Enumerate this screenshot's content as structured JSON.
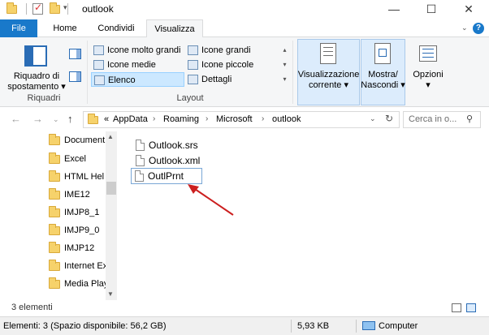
{
  "window": {
    "title": "outlook"
  },
  "ribbon": {
    "tabs": [
      "File",
      "Home",
      "Condividi",
      "Visualizza"
    ],
    "active_tab": "Visualizza",
    "panes_group": {
      "label": "Riquadri",
      "button_line1": "Riquadro di",
      "button_line2": "spostamento"
    },
    "layout_group": {
      "label": "Layout",
      "items": [
        "Icone molto grandi",
        "Icone grandi",
        "Icone medie",
        "Icone piccole",
        "Elenco",
        "Dettagli"
      ],
      "selected": "Elenco"
    },
    "current_view": {
      "line1": "Visualizzazione",
      "line2": "corrente"
    },
    "show_hide": {
      "line1": "Mostra/",
      "line2": "Nascondi"
    },
    "options": {
      "label": "Opzioni"
    }
  },
  "address": {
    "breadcrumbs": [
      "AppData",
      "Roaming",
      "Microsoft",
      "outlook"
    ],
    "prefix": "«",
    "search_placeholder": "Cerca in o..."
  },
  "nav_pane": {
    "items": [
      "Document",
      "Excel",
      "HTML Hel",
      "IME12",
      "IMJP8_1",
      "IMJP9_0",
      "IMJP12",
      "Internet Ex",
      "Media Play"
    ]
  },
  "files": [
    "Outlook.srs",
    "Outlook.xml",
    "OutlPrnt"
  ],
  "editing_file": "OutlPrnt",
  "annotation": {
    "arrow_color": "#cc1f1f"
  },
  "status": {
    "item_count": "3 elementi",
    "details": "Elementi: 3 (Spazio disponibile: 56,2 GB)",
    "size": "5,93 KB",
    "location": "Computer"
  },
  "colors": {
    "file_tab": "#1979ca",
    "selected_bg": "#cce8ff"
  }
}
